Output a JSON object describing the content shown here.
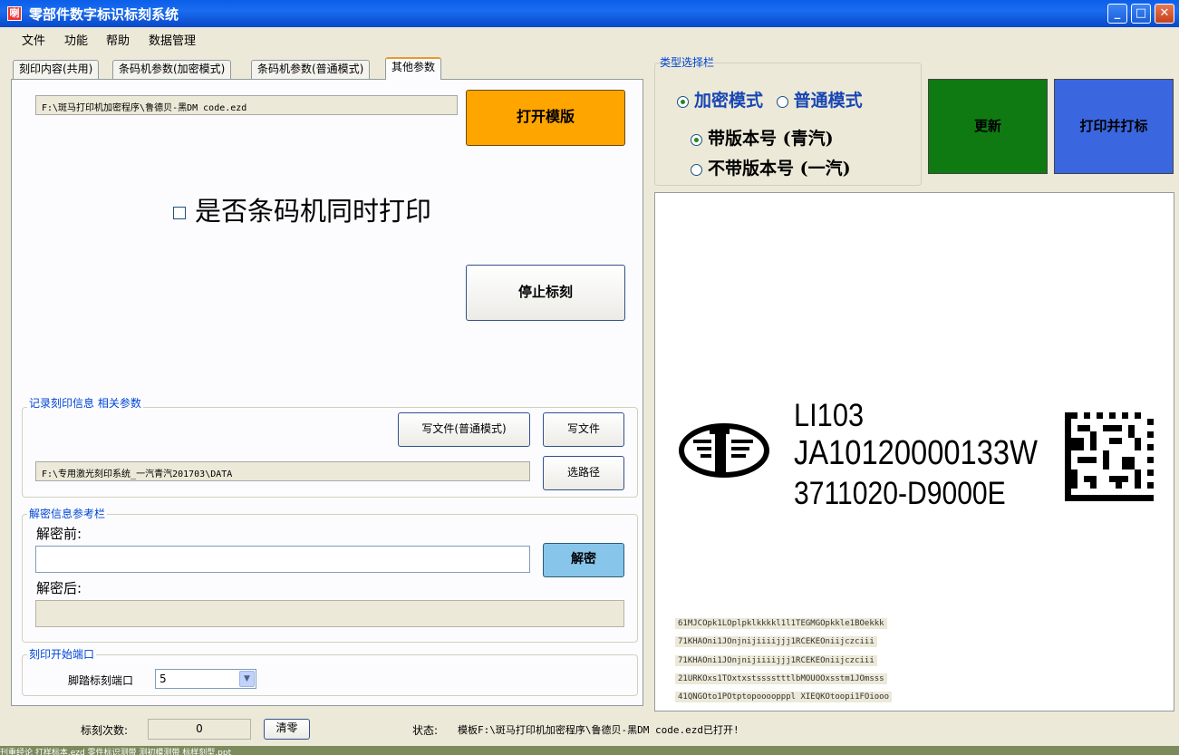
{
  "window": {
    "title": "零部件数字标识标刻系统",
    "icon_text": "喇",
    "minimize": "_",
    "maximize": "□",
    "close": "✕"
  },
  "menu": [
    "文件",
    "功能",
    "帮助",
    "数据管理"
  ],
  "tabs": [
    "刻印内容(共用)",
    "条码机参数(加密模式)",
    "条码机参数(普通模式)",
    "其他参数"
  ],
  "active_tab": 3,
  "other_params": {
    "template_path": "F:\\斑马打印机加密程序\\鲁德贝-黑DM code.ezd",
    "open_template_label": "打开模版",
    "barcode_sync_label": "是否条码机同时打印",
    "stop_marking_label": "停止标刻",
    "record_group": {
      "legend": "记录刻印信息 相关参数",
      "write_normal_label": "写文件(普通模式)",
      "write_label": "写文件",
      "data_path": "F:\\专用激光刻印系统_一汽青汽201703\\DATA",
      "select_path_label": "选路径"
    },
    "decrypt_group": {
      "legend": "解密信息参考栏",
      "before_label": "解密前:",
      "before_value": "",
      "decrypt_label": "解密",
      "after_label": "解密后:",
      "after_value": ""
    },
    "port_group": {
      "legend": "刻印开始端口",
      "pedal_label": "脚踏标刻端口",
      "pedal_value": "5"
    }
  },
  "type_panel": {
    "legend": "类型选择栏",
    "encrypt_label": "加密模式",
    "normal_label": "普通模式",
    "with_version_label": "带版本号 (青汽)",
    "without_version_label": "不带版本号 (一汽)",
    "selected_mode": "encrypt",
    "selected_version": "with"
  },
  "actions": {
    "update_label": "更新",
    "print_label": "打印并打标",
    "update_color": "#0f7a12",
    "print_color": "#3a66e0",
    "open_color": "#ffa500"
  },
  "preview": {
    "line1": "LI103",
    "line2": "JA10120000133W",
    "line3": "3711020-D9000E",
    "codes": [
      "61MJCOpk1LOplpklkkkkl1l1TEGMGOpkkle1BOekkk",
      "71KHAOni1JOnjnijiiiijjj1RCEKEOniijczciii",
      "71KHAOni1JOnjnijiiiijjj1RCEKEOniijczciii",
      "21URKOxs1TOxtxstsssstttlbMOUOOxsstm1JOmsss",
      "41QNGOto1POtptopoooopppl XIEQKOtoopi1FOiooo"
    ]
  },
  "status": {
    "count_label": "标刻次数:",
    "count_value": "0",
    "reset_label": "清零",
    "state_label": "状态:",
    "state_value": "模板F:\\斑马打印机加密程序\\鲁德贝-黑DM code.ezd已打开!"
  },
  "taskbar_text": "刊重经论    打样标本.ezd                零件标识测带 测初模测带                          标样刻型.ppt"
}
